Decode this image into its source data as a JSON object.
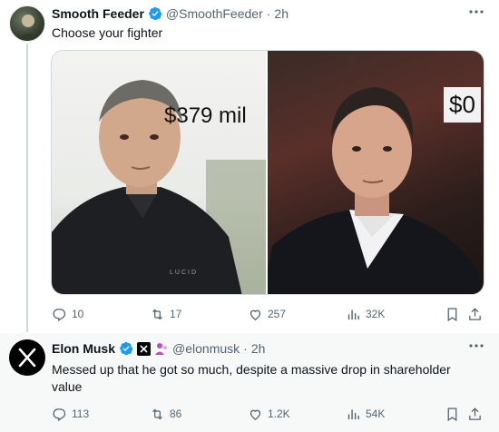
{
  "tweet1": {
    "display_name": "Smooth Feeder",
    "handle": "@SmoothFeeder",
    "separator": "·",
    "time": "2h",
    "text": "Choose your fighter",
    "media": {
      "left_caption": "$379 mil",
      "right_caption": "$0"
    },
    "stats": {
      "replies": "10",
      "reposts": "17",
      "likes": "257",
      "views": "32K"
    },
    "more_icon": "more-dots-icon"
  },
  "tweet2": {
    "display_name": "Elon Musk",
    "handle": "@elonmusk",
    "separator": "·",
    "time": "2h",
    "text": "Messed up that he got so much, despite a massive drop in shareholder value",
    "stats": {
      "replies": "113",
      "reposts": "86",
      "likes": "1.2K",
      "views": "54K"
    }
  },
  "colors": {
    "verified": "#1d9bf0",
    "secondary_text": "#536471",
    "reply_background": "#f7f9f9",
    "affiliate_badge": "#c04bc7"
  }
}
